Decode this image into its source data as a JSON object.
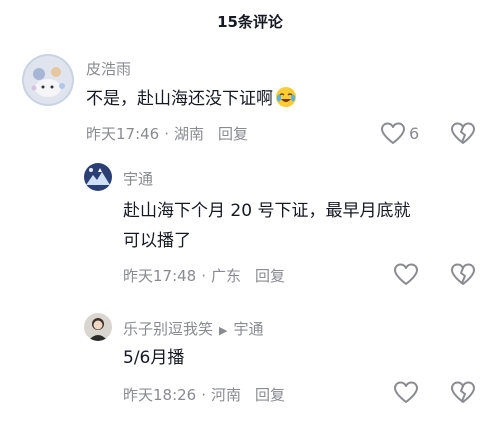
{
  "header": {
    "title": "15条评论"
  },
  "comments": [
    {
      "author": "皮浩雨",
      "text": "不是，赴山海还没下证啊",
      "emoji": "crying-laughing-emoji",
      "time": "昨天17:46",
      "location": "湖南",
      "reply_label": "回复",
      "like_count": "6"
    },
    {
      "author": "宇通",
      "text_line1": "赴山海下个月 20 号下证，最早月底就",
      "text_line2": "可以播了",
      "time": "昨天17:48",
      "location": "广东",
      "reply_label": "回复"
    },
    {
      "author": "乐子别逗我笑",
      "reply_to": "宇通",
      "text": "5/6月播",
      "time": "昨天18:26",
      "location": "河南",
      "reply_label": "回复"
    }
  ],
  "colors": {
    "text": "#161823",
    "muted": "#8a8b91",
    "background": "#ffffff"
  }
}
